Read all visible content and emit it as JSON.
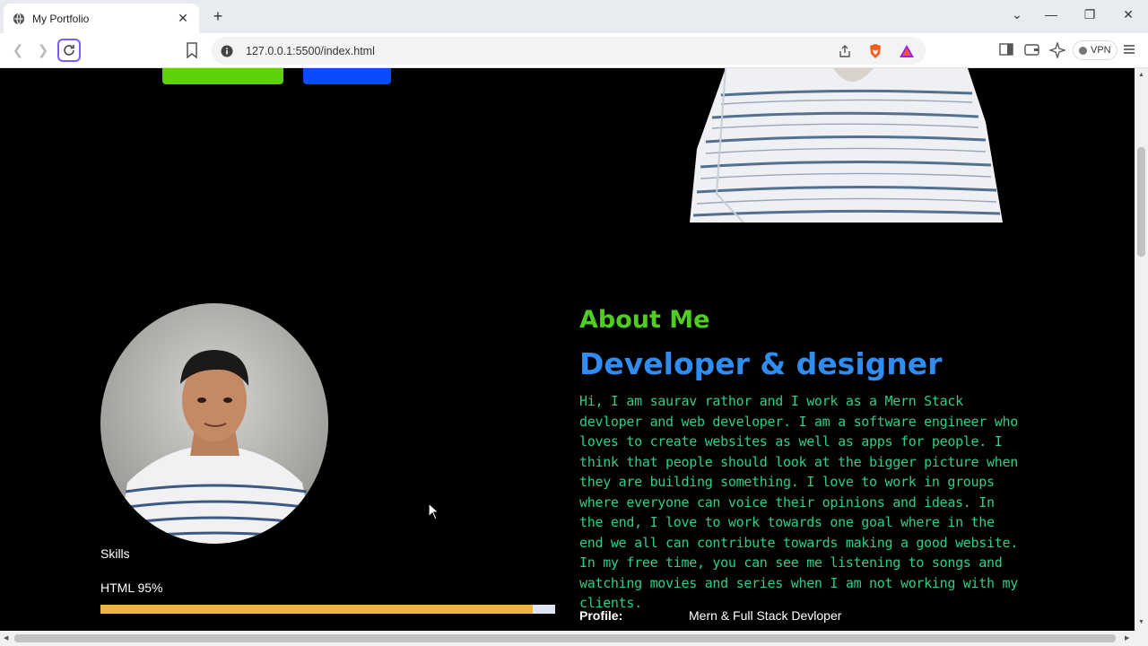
{
  "browser": {
    "tab_title": "My Portfolio",
    "url": "127.0.0.1:5500/index.html",
    "vpn_label": "VPN"
  },
  "page": {
    "about": {
      "title": "About Me",
      "subtitle": "Developer & designer",
      "text": "Hi, I am saurav rathor and I work as a Mern Stack devloper and web developer. I am a software engineer who loves to create websites as well as apps for people. I think that people should look at the bigger picture when they are building something. I love to work in groups where everyone can voice their opinions and ideas. In the end, I love to work towards one goal where in the end we all can contribute towards making a good website. In my free time, you can see me listening to songs and watching movies and series when I am not working with my clients."
    },
    "skills": {
      "label": "Skills",
      "items": [
        {
          "name": "HTML 95%",
          "percent": 95
        }
      ]
    },
    "profile": {
      "label": "Profile:",
      "value": "Mern & Full Stack Devloper"
    }
  },
  "colors": {
    "about_title": "#4fce1f",
    "about_subtitle": "#2f8cf0",
    "about_text": "#2ccf84",
    "skill_fill": "#f2b53c",
    "button_green": "#5dd10c",
    "button_blue": "#0a4bff"
  }
}
